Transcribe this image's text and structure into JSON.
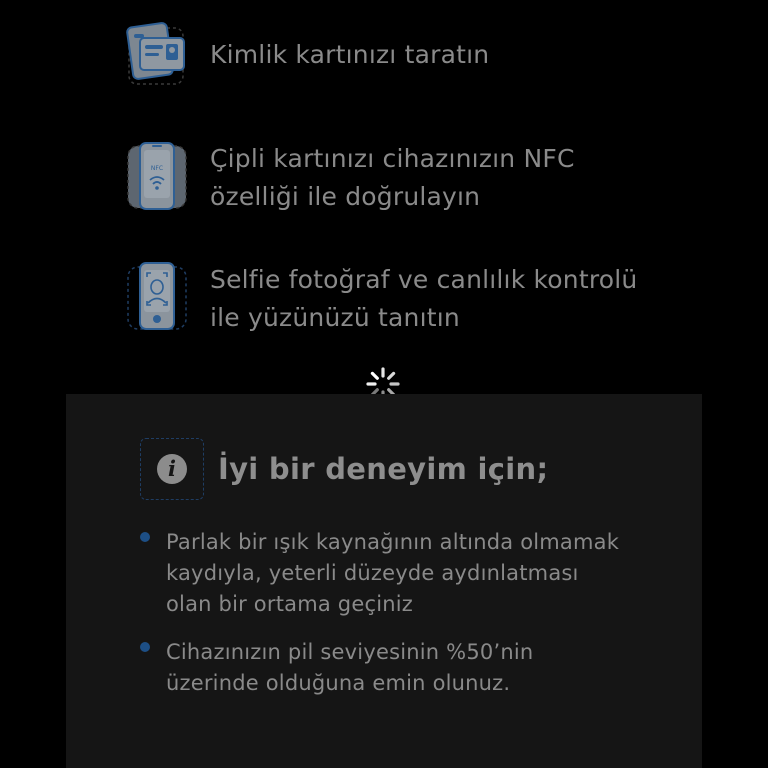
{
  "steps": [
    {
      "icon": "id-card-scan-icon",
      "text": "Kimlik kartınızı taratın"
    },
    {
      "icon": "nfc-phone-icon",
      "text": "Çipli kartınızı cihazınızın NFC\nözelliği ile doğrulayın"
    },
    {
      "icon": "face-scan-phone-icon",
      "text": "Selfie fotoğraf ve canlılık kontrolü\nile yüzünüzü tanıtın"
    }
  ],
  "spinner": {
    "icon": "loading-spinner-icon"
  },
  "info": {
    "icon_glyph": "i",
    "title": "İyi bir deneyim için;",
    "tips": [
      {
        "text": "Parlak bir ışık kaynağının altında olmamak\nkaydıyla, yeterli düzeyde aydınlatması\nolan bir ortama geçiniz"
      },
      {
        "text": "Cihazınızın pil seviyesinin %50’nin\nüzerinde olduğuna emin olunuz."
      }
    ]
  },
  "colors": {
    "background": "#000000",
    "panel": "#151515",
    "text": "#8a8a8a",
    "accent_blue": "#1d4f86",
    "icon_blue": "#2e5f94"
  }
}
